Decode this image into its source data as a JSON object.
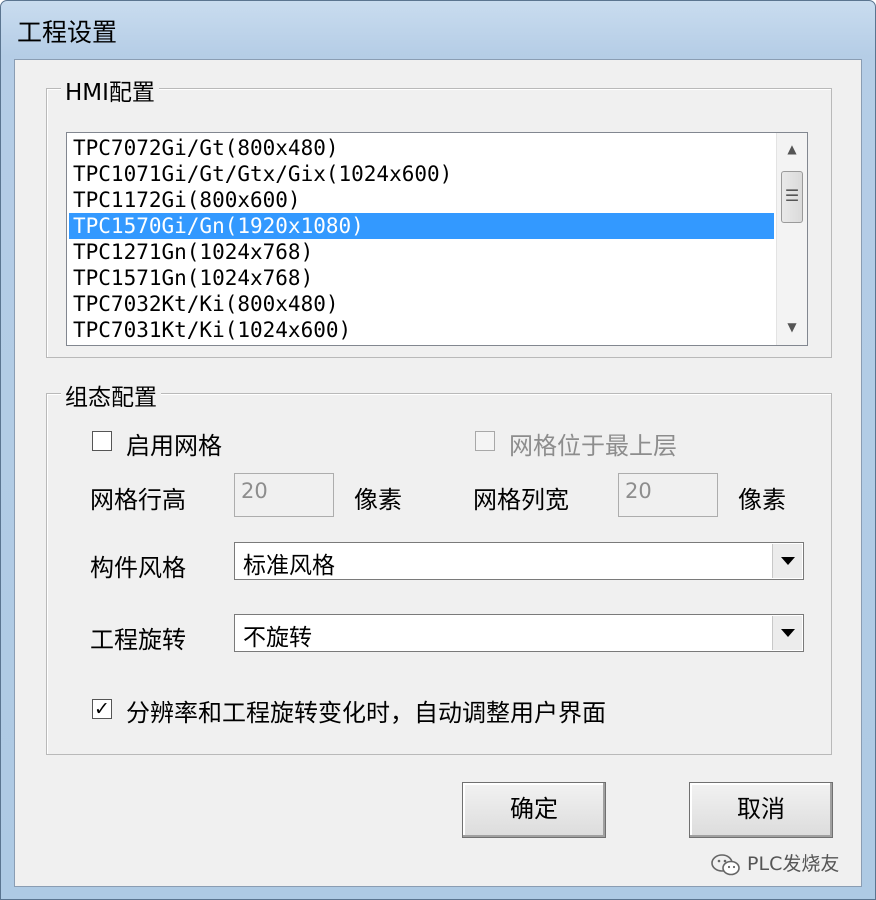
{
  "window": {
    "title": "工程设置"
  },
  "hmi_group": {
    "title": "HMI配置",
    "items": [
      "TPC7072Gi/Gt(800x480)",
      "TPC1071Gi/Gt/Gtx/Gix(1024x600)",
      "TPC1172Gi(800x600)",
      "TPC1570Gi/Gn(1920x1080)",
      "TPC1271Gn(1024x768)",
      "TPC1571Gn(1024x768)",
      "TPC7032Kt/Ki(800x480)",
      "TPC7031Kt/Ki(1024x600)"
    ],
    "selected": "TPC1570Gi/Gn(1920x1080)"
  },
  "config_group": {
    "title": "组态配置",
    "enable_grid": {
      "label": "启用网格",
      "checked": false
    },
    "grid_on_top": {
      "label": "网格位于最上层",
      "checked": false,
      "enabled": false
    },
    "grid_row_height": {
      "label": "网格行高",
      "value": "20",
      "unit": "像素"
    },
    "grid_col_width": {
      "label": "网格列宽",
      "value": "20",
      "unit": "像素"
    },
    "component_style": {
      "label": "构件风格",
      "value": "标准风格"
    },
    "project_rotation": {
      "label": "工程旋转",
      "value": "不旋转"
    },
    "auto_adjust": {
      "label": "分辨率和工程旋转变化时，自动调整用户界面",
      "checked": true
    }
  },
  "buttons": {
    "ok": "确定",
    "cancel": "取消"
  },
  "watermark": {
    "text": "PLC发烧友",
    "icon": "wechat-icon"
  },
  "icons": {
    "check": "✓"
  },
  "colors": {
    "selection": "#3399ff",
    "title_bar": "#b9d1ea",
    "dialog_bg": "#f0f0f0"
  }
}
